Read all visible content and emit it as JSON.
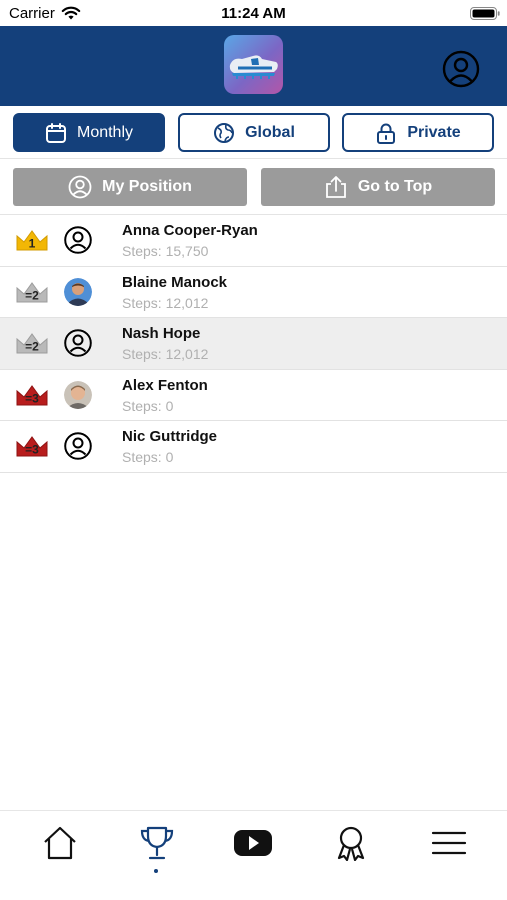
{
  "status_bar": {
    "carrier": "Carrier",
    "time": "11:24 AM"
  },
  "header": {
    "logo_icon": "running-shoe-logo",
    "profile_icon": "user-circle-icon"
  },
  "filters": {
    "tabs": [
      {
        "label": "Monthly",
        "icon": "calendar-icon",
        "active": true
      },
      {
        "label": "Global",
        "icon": "globe-icon",
        "active": false
      },
      {
        "label": "Private",
        "icon": "lock-icon",
        "active": false
      }
    ]
  },
  "actions": {
    "my_position": "My Position",
    "go_to_top": "Go to Top"
  },
  "leaderboard": {
    "rows": [
      {
        "rank": "1",
        "name": "Anna Cooper-Ryan",
        "steps": "Steps: 15,750",
        "crown": "gold",
        "avatar": "default",
        "highlighted": false
      },
      {
        "rank": "=2",
        "name": "Blaine Manock",
        "steps": "Steps: 12,012",
        "crown": "silver",
        "avatar": "photo",
        "highlighted": false
      },
      {
        "rank": "=2",
        "name": "Nash Hope",
        "steps": "Steps: 12,012",
        "crown": "silver",
        "avatar": "default",
        "highlighted": true
      },
      {
        "rank": "=3",
        "name": "Alex Fenton",
        "steps": "Steps: 0",
        "crown": "bronze",
        "avatar": "photo",
        "highlighted": false
      },
      {
        "rank": "=3",
        "name": "Nic Guttridge",
        "steps": "Steps: 0",
        "crown": "bronze",
        "avatar": "default",
        "highlighted": false
      }
    ]
  },
  "tabbar": {
    "items": [
      "home-icon",
      "trophy-icon",
      "youtube-icon",
      "award-ribbon-icon",
      "menu-icon"
    ],
    "selected": "trophy-icon"
  },
  "colors": {
    "brand": "#14407b",
    "gold": "#f2b705",
    "silver": "#b9b9b9",
    "bronze": "#b81d1d",
    "action_button": "#9b9b9b"
  }
}
